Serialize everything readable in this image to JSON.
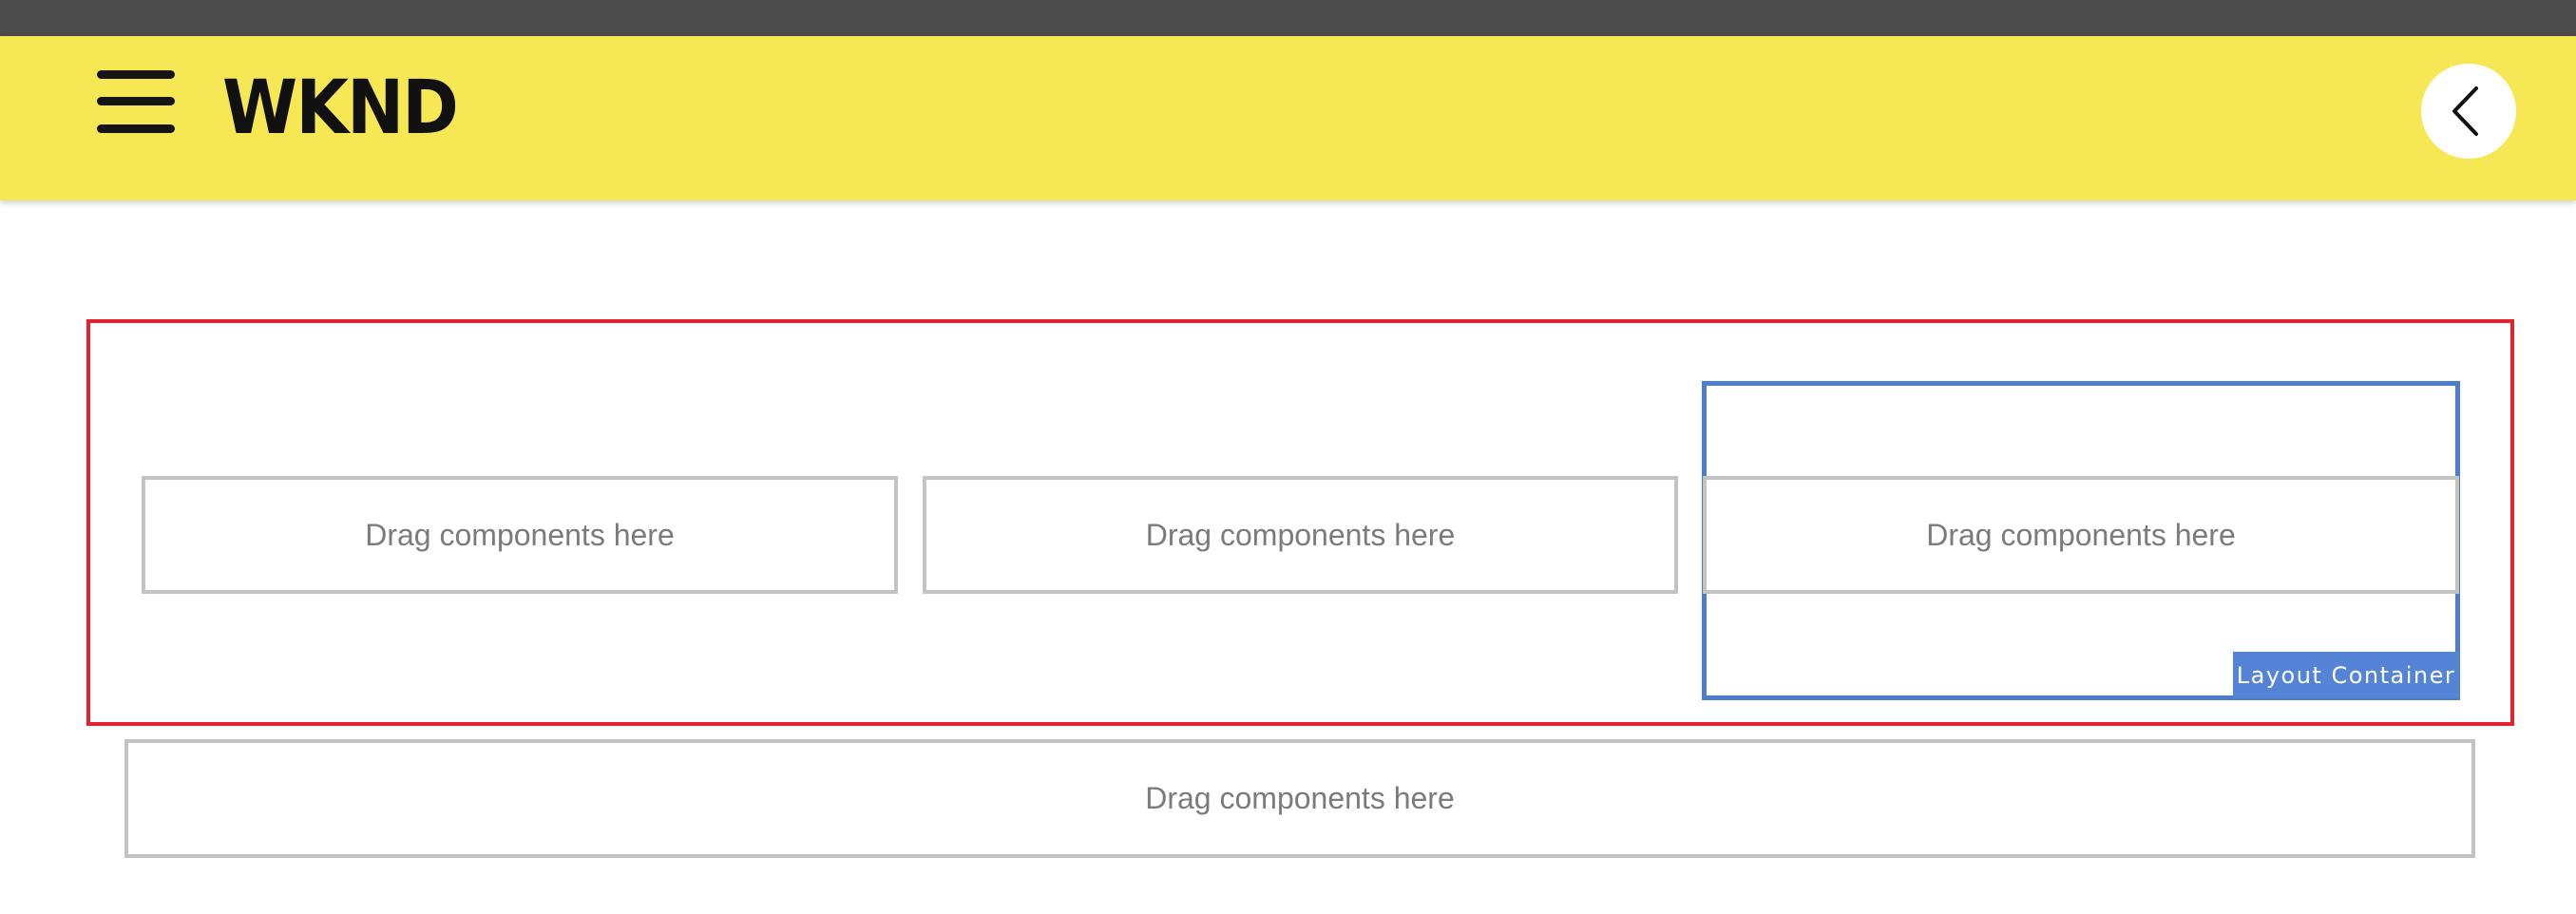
{
  "header": {
    "logo_text": "WKND",
    "menu_icon": "hamburger-menu-icon",
    "back_icon": "chevron-left-icon",
    "colors": {
      "top_bar": "#4b4b4b",
      "header_background": "#f5e854",
      "logo": "#111111"
    }
  },
  "editor": {
    "outer_container": {
      "border_color": "#e2222e",
      "columns": [
        {
          "placeholder": "Drag components here"
        },
        {
          "placeholder": "Drag components here"
        },
        {
          "placeholder": "Drag components here"
        }
      ]
    },
    "selected_container": {
      "label": "Layout Container",
      "border_color": "#4b7ece"
    },
    "bottom_placeholder": "Drag components here"
  }
}
